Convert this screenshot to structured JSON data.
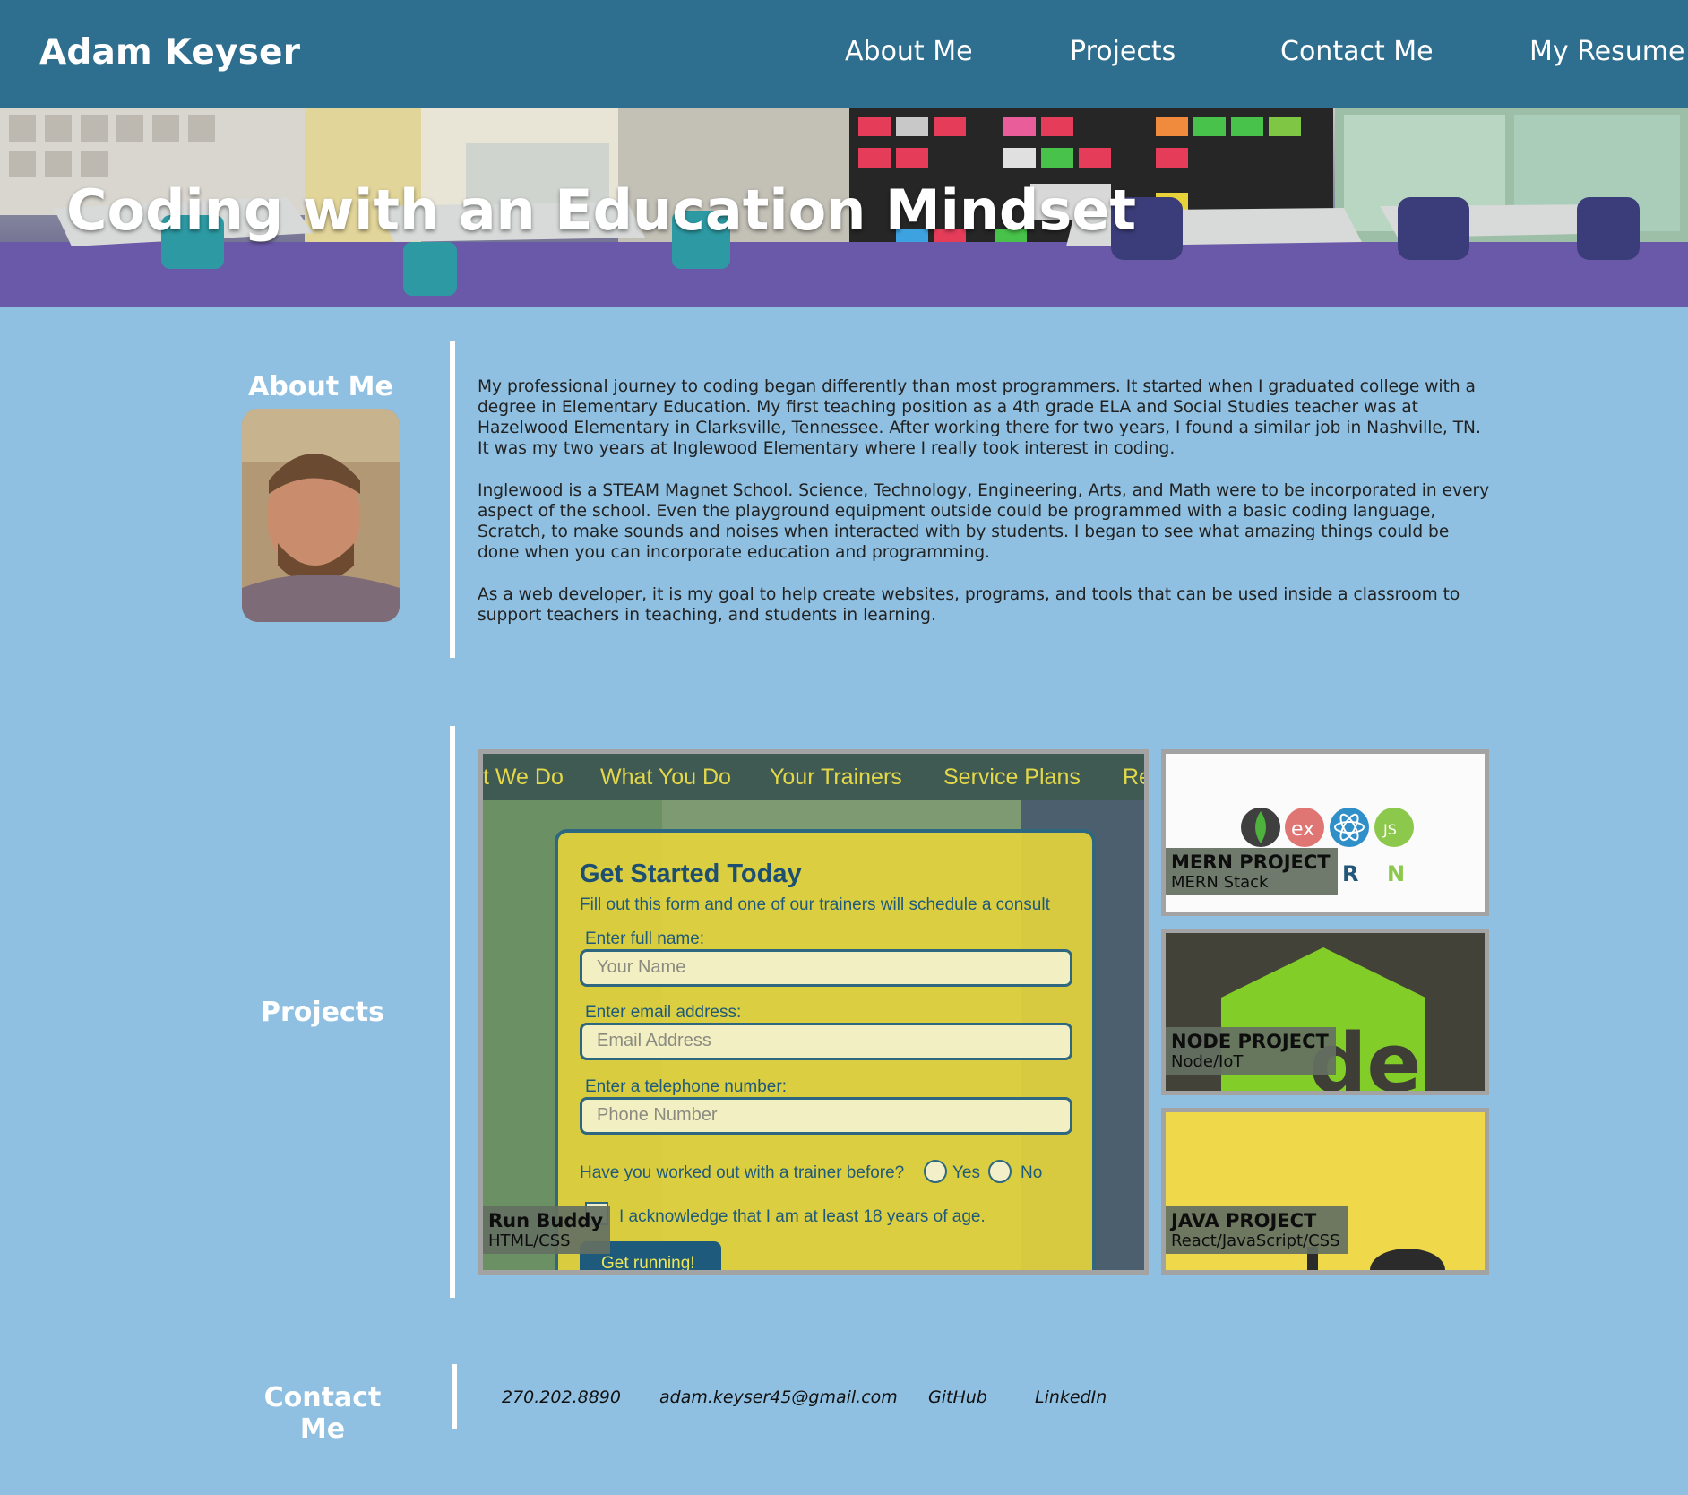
{
  "header": {
    "brand": "Adam Keyser",
    "nav": [
      {
        "label": "About Me"
      },
      {
        "label": "Projects"
      },
      {
        "label": "Contact Me"
      },
      {
        "label": "My Resume"
      }
    ]
  },
  "hero": {
    "title": "Coding with an Education Mindset"
  },
  "about": {
    "heading": "About Me",
    "paragraphs": [
      "My professional journey to coding began differently than most programmers. It started when I graduated college with a degree in Elementary Education. My first teaching position as a 4th grade ELA and Social Studies teacher was at Hazelwood Elementary in Clarksville, Tennessee. After working there for two years, I found a similar job in Nashville, TN. It was my two years at Inglewood Elementary where I really took interest in coding.",
      "Inglewood is a STEAM Magnet School. Science, Technology, Engineering, Arts, and Math were to be incorporated in every aspect of the school. Even the playground equipment outside could be programmed with a basic coding language, Scratch, to make sounds and noises when interacted with by students. I began to see what amazing things could be done when you can incorporate education and programming.",
      "As a web developer, it is my goal to help create websites, programs, and tools that can be used inside a classroom to support teachers in teaching, and students in learning."
    ]
  },
  "projects": {
    "heading": "Projects",
    "featured": {
      "title": "Run Buddy",
      "subtitle": "HTML/CSS",
      "screenshot": {
        "nav": [
          "t We Do",
          "What You Do",
          "Your Trainers",
          "Service Plans",
          "Re"
        ],
        "form_title": "Get Started Today",
        "form_subtitle": "Fill out this form and one of our trainers will schedule a consult",
        "name_label": "Enter full name:",
        "name_placeholder": "Your Name",
        "email_label": "Enter email address:",
        "email_placeholder": "Email Address",
        "phone_label": "Enter a telephone number:",
        "phone_placeholder": "Phone Number",
        "question": "Have you worked out with a trainer before?",
        "yes": "Yes",
        "no": "No",
        "ack": "I acknowledge that I am at least 18 years of age.",
        "button": "Get running!"
      }
    },
    "cards": [
      {
        "title": "MERN PROJECT",
        "subtitle": "MERN Stack",
        "logo_letters": [
          "R",
          "N"
        ]
      },
      {
        "title": "NODE PROJECT",
        "subtitle": "Node/IoT"
      },
      {
        "title": "JAVA PROJECT",
        "subtitle": "React/JavaScript/CSS"
      }
    ]
  },
  "contact": {
    "heading": "Contact Me",
    "links": [
      {
        "label": "270.202.8890"
      },
      {
        "label": "adam.keyser45@gmail.com"
      },
      {
        "label": "GitHub"
      },
      {
        "label": "LinkedIn"
      }
    ]
  }
}
